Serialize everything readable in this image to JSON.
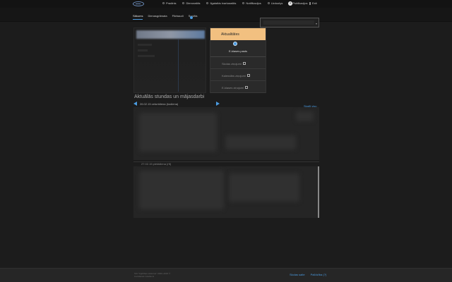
{
  "topnav": {
    "items": [
      {
        "label": "Pradinis",
        "icon": "home-icon"
      },
      {
        "label": "Dienoraštis",
        "icon": "diary-icon"
      },
      {
        "label": "Ilgalaikis tvarkaraštis",
        "icon": "calendar-icon"
      },
      {
        "label": "Notifikacijos",
        "icon": "bell-icon"
      },
      {
        "label": "Uzduotys",
        "icon": "tasks-icon"
      },
      {
        "label": "Publikacijos",
        "icon": "globe-icon"
      }
    ],
    "help_glyph": "?",
    "exit_label": "Exit"
  },
  "tabs": [
    "Sākums",
    "Dienasgrāmata",
    "Pārbaudi",
    "Sociāls"
  ],
  "active_tab": 0,
  "search": {
    "value": "",
    "arrow": "▾"
  },
  "side_menu": {
    "active_label": "Aktualitātes",
    "email_label": "E-klases pasts",
    "items": [
      {
        "label": "Skolas ziņojumi",
        "icon": "envelope-icon"
      },
      {
        "label": "Kalendārs ziņojumi",
        "icon": "calendar-icon"
      },
      {
        "label": "E-klases ziņojumi",
        "icon": "eye-icon"
      }
    ]
  },
  "main": {
    "heading": "Aktuālās stundas un mājasdarbi",
    "date_range": "26.02.15 ceturtdiena (šodiena)",
    "show_all": "Skatīt visu",
    "second_date": "27.02.15 piektdiena (rīt)"
  },
  "footer": {
    "copyright_line1": "SIA \"Izglītības sistēmas\" 2000–2015 ©",
    "copyright_line2": "Lietošanas noteikumi",
    "links": [
      "Skolas saite",
      "Palīdzība (?)"
    ]
  },
  "colors": {
    "accent": "#4a9be0",
    "active_menu": "#f2c080",
    "background": "#1c1c1c"
  }
}
